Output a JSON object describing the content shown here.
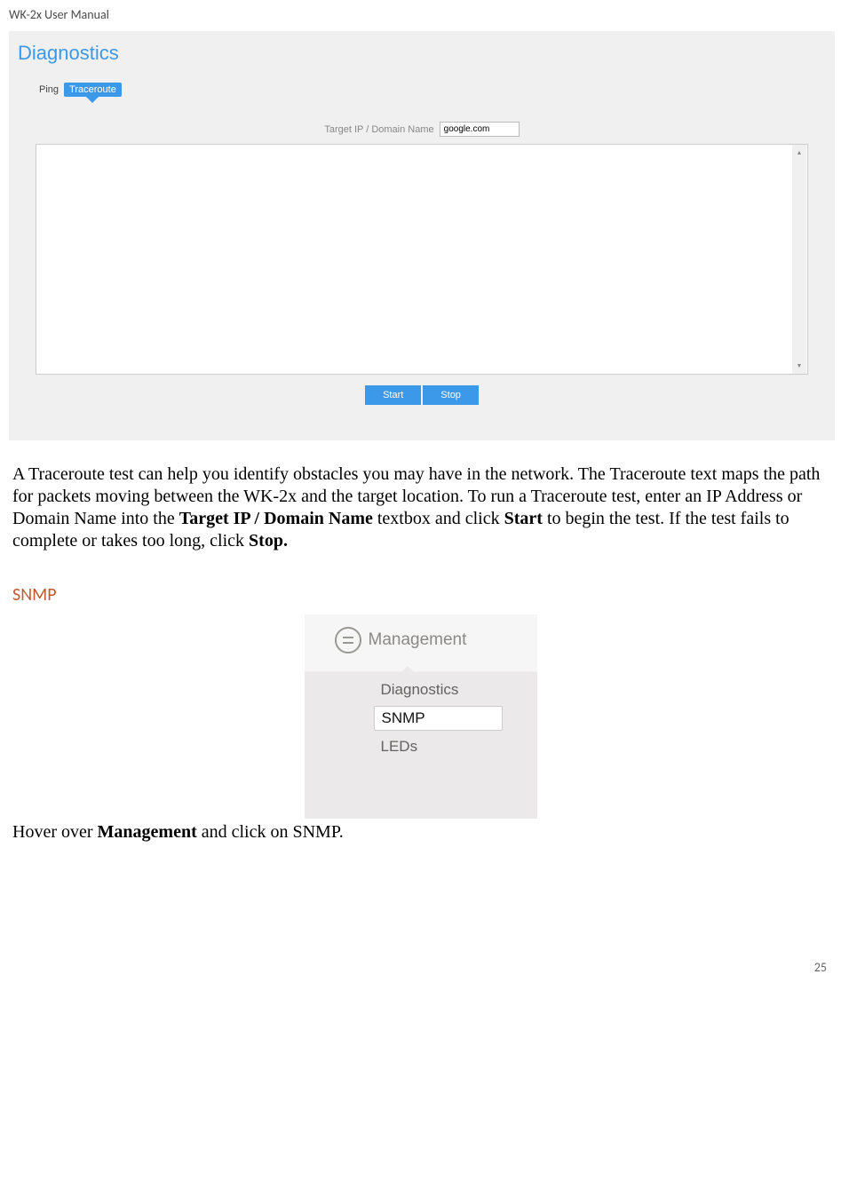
{
  "doc_header": "WK-2x User Manual",
  "screenshot1": {
    "title": "Diagnostics",
    "tabs": {
      "ping": "Ping",
      "traceroute": "Traceroute"
    },
    "input_label": "Target IP / Domain Name",
    "input_value": "google.com",
    "buttons": {
      "start": "Start",
      "stop": "Stop"
    }
  },
  "paragraph": {
    "p1a": "A Traceroute test can help you identify obstacles you may have in the network. The Traceroute text maps the path for packets moving between the WK-2x and the target location. To run a Traceroute test, enter an IP Address or Domain Name into the ",
    "b1": "Target IP / Domain Name",
    "p1b": " textbox and click ",
    "b2": "Start",
    "p1c": " to begin the test. If the test fails to complete or takes too long, click ",
    "b3": "Stop.",
    "p1d": ""
  },
  "section_heading": "SNMP",
  "dropdown": {
    "header": "Management",
    "items": [
      "Diagnostics",
      "SNMP",
      "LEDs"
    ],
    "selected_index": 1
  },
  "paragraph2": {
    "a": "Hover over ",
    "b": "Management",
    "c": " and click on SNMP."
  },
  "page_number": "25"
}
